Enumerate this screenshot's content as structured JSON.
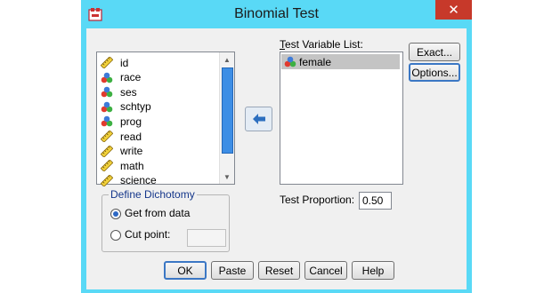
{
  "window": {
    "title": "Binomial Test",
    "close_glyph": "✕"
  },
  "variables": [
    {
      "name": "id",
      "icon": "ruler-icon"
    },
    {
      "name": "race",
      "icon": "nominal-icon"
    },
    {
      "name": "ses",
      "icon": "nominal-icon"
    },
    {
      "name": "schtyp",
      "icon": "nominal-icon"
    },
    {
      "name": "prog",
      "icon": "nominal-icon"
    },
    {
      "name": "read",
      "icon": "ruler-icon"
    },
    {
      "name": "write",
      "icon": "ruler-icon"
    },
    {
      "name": "math",
      "icon": "ruler-icon"
    },
    {
      "name": "science",
      "icon": "ruler-icon"
    }
  ],
  "test_variable_list": {
    "label": "Test Variable List:",
    "items": [
      {
        "name": "female",
        "icon": "nominal-icon",
        "selected": true
      }
    ]
  },
  "buttons": {
    "exact": "Exact...",
    "options": "Options...",
    "ok": "OK",
    "paste": "Paste",
    "reset": "Reset",
    "cancel": "Cancel",
    "help": "Help"
  },
  "dichotomy": {
    "legend": "Define Dichotomy",
    "get_from_data": "Get from data",
    "cut_point": "Cut point:",
    "selected": "get_from_data",
    "cut_point_value": ""
  },
  "test_proportion": {
    "label": "Test Proportion:",
    "value": "0.50"
  },
  "colors": {
    "window_frame": "#59d9f6",
    "close_button": "#c7392a",
    "selection": "#c4c4c4",
    "scroll_thumb": "#3d8ee5"
  }
}
